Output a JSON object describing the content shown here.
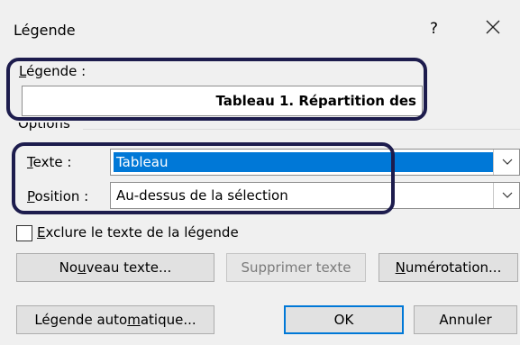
{
  "dialog": {
    "title": "Légende",
    "help": "?"
  },
  "caption": {
    "label_accel": "L",
    "label_rest": "égende :",
    "value": "Tableau 1. Répartition des"
  },
  "options": {
    "group_label": "Options",
    "texte_label_accel": "T",
    "texte_label_rest": "exte :",
    "texte_value": "Tableau",
    "position_label_accel": "P",
    "position_label_rest": "osition :",
    "position_value": "Au-dessus de la sélection"
  },
  "exclude": {
    "label_accel": "E",
    "label_rest": "xclure le texte de la légende"
  },
  "buttons": {
    "new_pre": "No",
    "new_accel": "u",
    "new_post": "veau texte...",
    "delete": "Supprimer texte",
    "numbering_accel": "N",
    "numbering_rest": "umérotation...",
    "auto_pre": "Légende auto",
    "auto_accel": "m",
    "auto_post": "atique...",
    "ok": "OK",
    "cancel": "Annuler"
  }
}
